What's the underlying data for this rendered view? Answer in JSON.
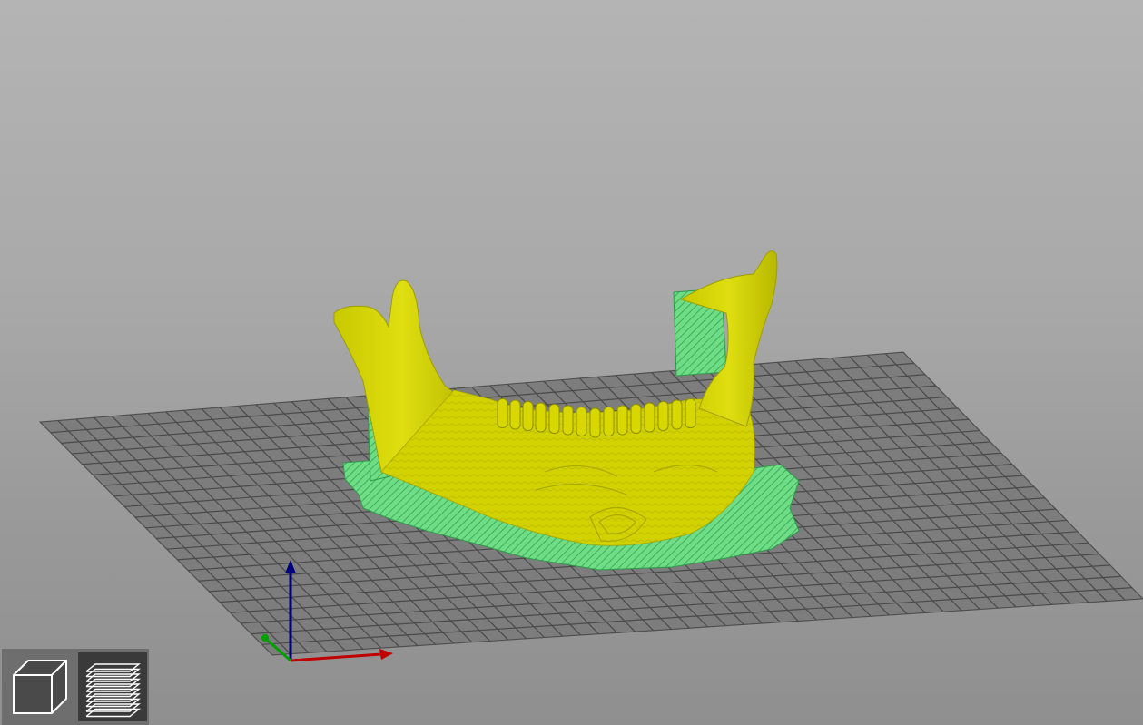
{
  "app": {
    "view": "3d-preview",
    "colors": {
      "background_top": "#b4b4b4",
      "background_bottom": "#8f8f8f",
      "bed_grid": "#4a4a4a",
      "bed_fill": "#7a7a7a",
      "model": "#d6d600",
      "support": "#5fd37a",
      "axis_x": "#c00000",
      "axis_y": "#00a000",
      "axis_z": "#00007a"
    }
  },
  "scene": {
    "object_name": "mandible-model",
    "bed": "print-bed-grid",
    "axes": [
      "x-axis",
      "y-axis",
      "z-axis"
    ]
  },
  "view_toggle": {
    "buttons": [
      {
        "name": "3d-view",
        "icon": "cube-icon",
        "active": false
      },
      {
        "name": "preview-layers",
        "icon": "layers-icon",
        "active": true
      }
    ]
  }
}
